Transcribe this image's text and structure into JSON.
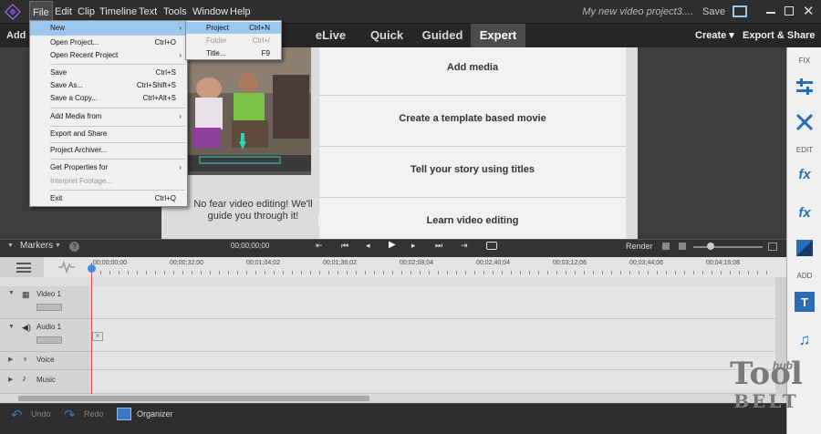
{
  "app": {
    "project_title": "My new video project3....",
    "save_label": "Save"
  },
  "menu": [
    "File",
    "Edit",
    "Clip",
    "Timeline",
    "Text",
    "Tools",
    "Window",
    "Help"
  ],
  "modes": {
    "add_media_trunc": "Add M",
    "tabs": [
      "eLive",
      "Quick",
      "Guided",
      "Expert"
    ],
    "selected": "Expert",
    "create_label": "Create ▾",
    "export_label": "Export & Share"
  },
  "file_menu": [
    {
      "label": "New",
      "shortcut": "",
      "sub": true,
      "highlight": true
    },
    {
      "label": "Open Project...",
      "shortcut": "Ctrl+O"
    },
    {
      "label": "Open Recent Project",
      "shortcut": "",
      "sub": true
    },
    {
      "label": "Save",
      "shortcut": "Ctrl+S"
    },
    {
      "label": "Save As...",
      "shortcut": "Ctrl+Shift+S"
    },
    {
      "label": "Save a Copy...",
      "shortcut": "Ctrl+Alt+S"
    },
    {
      "label": "Add Media from",
      "shortcut": "",
      "sub": true
    },
    {
      "label": "Export and Share",
      "shortcut": ""
    },
    {
      "label": "Project Archiver...",
      "shortcut": ""
    },
    {
      "label": "Get Properties for",
      "shortcut": "",
      "sub": true
    },
    {
      "label": "Interpret Footage...",
      "shortcut": "",
      "disabled": true
    },
    {
      "label": "Exit",
      "shortcut": "Ctrl+Q"
    }
  ],
  "new_submenu": [
    {
      "label": "Project",
      "shortcut": "Ctrl+N",
      "highlight": true
    },
    {
      "label": "Folder",
      "shortcut": "Ctrl+/",
      "disabled": true
    },
    {
      "label": "Title...",
      "shortcut": "F9"
    }
  ],
  "welcome": {
    "tagline": "No fear video editing! We'll guide you through it!",
    "options": [
      "Add media",
      "Create a template based movie",
      "Tell your story using titles",
      "Learn video editing"
    ]
  },
  "right_panel": {
    "fix_label": "FIX",
    "edit_label": "EDIT",
    "add_label": "ADD"
  },
  "timeline": {
    "markers_label": "Markers",
    "timecode": "00;00;00;00",
    "render_label": "Render",
    "ruler": [
      "00;00;00;00",
      "00;00;32;00",
      "00;01;04;02",
      "00;01;36;02",
      "00;02;08;04",
      "00;02;40;04",
      "00;03;12;06",
      "00;03;44;06",
      "00;04;16;08"
    ],
    "tracks": [
      "Video 1",
      "Audio 1",
      "Voice",
      "Music"
    ]
  },
  "bottom": {
    "undo": "Undo",
    "redo": "Redo",
    "organizer": "Organizer"
  },
  "watermark": {
    "line1": "Tool",
    "line2": "BELT",
    "small": "hub"
  }
}
